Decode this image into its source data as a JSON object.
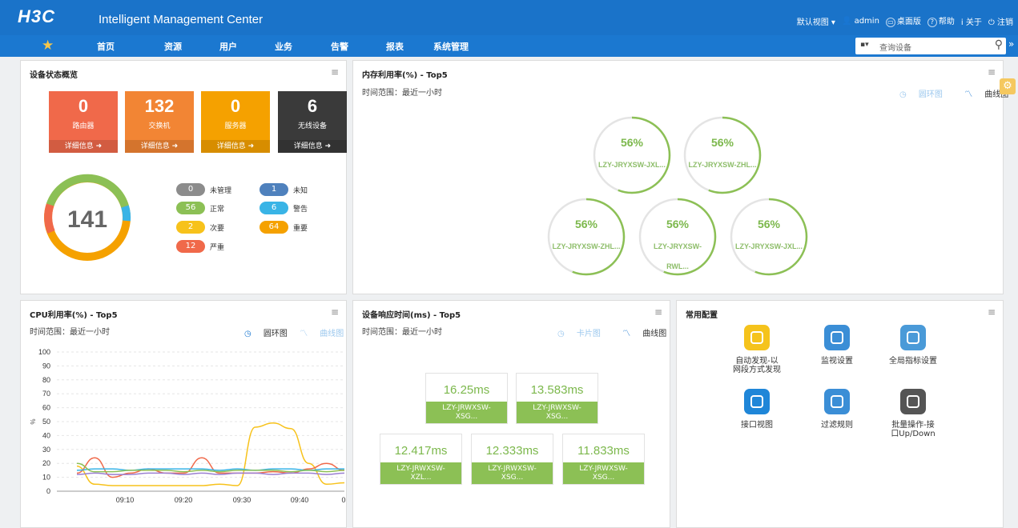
{
  "header": {
    "logo": "H3C",
    "title": "Intelligent Management Center",
    "default_view": "默认视图",
    "user": "admin",
    "desktop": "桌面版",
    "help": "帮助",
    "about": "关于",
    "logout": "注销"
  },
  "nav": {
    "items": [
      "首页",
      "资源",
      "用户",
      "业务",
      "告警",
      "报表",
      "系统管理"
    ],
    "search_placeholder": "查询设备"
  },
  "status_panel": {
    "title": "设备状态概览",
    "tiles": [
      {
        "value": "0",
        "label": "路由器",
        "more": "详细信息",
        "color": "#f0694a"
      },
      {
        "value": "132",
        "label": "交换机",
        "more": "详细信息",
        "color": "#f28534"
      },
      {
        "value": "0",
        "label": "服务器",
        "more": "详细信息",
        "color": "#f5a100"
      },
      {
        "value": "6",
        "label": "无线设备",
        "more": "详细信息",
        "color": "#3a3a3a"
      }
    ],
    "total": "141",
    "legend": [
      {
        "count": "0",
        "label": "未管理",
        "color": "#8c8c8c"
      },
      {
        "count": "1",
        "label": "未知",
        "color": "#4f81bd"
      },
      {
        "count": "56",
        "label": "正常",
        "color": "#8cc055"
      },
      {
        "count": "6",
        "label": "警告",
        "color": "#39b4e6"
      },
      {
        "count": "2",
        "label": "次要",
        "color": "#f7c21b"
      },
      {
        "count": "64",
        "label": "重要",
        "color": "#f5a100"
      },
      {
        "count": "12",
        "label": "严重",
        "color": "#f0694a"
      }
    ]
  },
  "memory_panel": {
    "title": "内存利用率(%) - Top5",
    "time_range": "时间范围：最近一小时",
    "ring_view": "圆环图",
    "line_view": "曲线图",
    "gauges": [
      {
        "pct": "56%",
        "name": "LZY-JRYXSW-JXL..."
      },
      {
        "pct": "56%",
        "name": "LZY-JRYXSW-ZHL..."
      },
      {
        "pct": "56%",
        "name": "LZY-JRYXSW-ZHL..."
      },
      {
        "pct": "56%",
        "name": "LZY-JRYXSW-",
        "name2": "RWL..."
      },
      {
        "pct": "56%",
        "name": "LZY-JRYXSW-JXL..."
      }
    ]
  },
  "cpu_panel": {
    "title": "CPU利用率(%) - Top5",
    "time_range": "时间范围：最近一小时",
    "ring_view": "圆环图",
    "line_view": "曲线图"
  },
  "chart_data": {
    "type": "line",
    "ylabel": "%",
    "ylim": [
      0,
      100
    ],
    "yticks": [
      0,
      10,
      20,
      30,
      40,
      50,
      60,
      70,
      80,
      90,
      100
    ],
    "xticks": [
      "09:10",
      "09:20",
      "09:30",
      "09:40",
      "0"
    ],
    "grid": true,
    "series": [
      {
        "color": "#f7c21b",
        "values": [
          18,
          5,
          4,
          4,
          4,
          4,
          4,
          4,
          5,
          4,
          46,
          49,
          45,
          20,
          5,
          6
        ]
      },
      {
        "color": "#f0694a",
        "values": [
          13,
          24,
          10,
          13,
          16,
          13,
          13,
          24,
          13,
          13,
          13,
          14,
          13,
          16,
          20,
          15
        ]
      },
      {
        "color": "#39b4e6",
        "values": [
          15,
          16,
          16,
          15,
          16,
          16,
          16,
          16,
          15,
          16,
          15,
          16,
          16,
          15,
          16,
          16
        ]
      },
      {
        "color": "#9a7fd1",
        "values": [
          12,
          13,
          12,
          12,
          13,
          13,
          12,
          13,
          12,
          13,
          13,
          12,
          13,
          13,
          12,
          13
        ]
      },
      {
        "color": "#8cc055",
        "values": [
          20,
          14,
          14,
          15,
          15,
          15,
          14,
          15,
          14,
          15,
          15,
          15,
          14,
          15,
          14,
          15
        ]
      }
    ]
  },
  "response_panel": {
    "title": "设备响应时间(ms) - Top5",
    "time_range": "时间范围：最近一小时",
    "card_view": "卡片图",
    "line_view": "曲线图",
    "cards": [
      {
        "value": "16.25ms",
        "name": "LZY-JRWXSW-",
        "name2": "XSG..."
      },
      {
        "value": "13.583ms",
        "name": "LZY-JRWXSW-",
        "name2": "XSG..."
      },
      {
        "value": "12.417ms",
        "name": "LZY-JRWXSW-",
        "name2": "XZL..."
      },
      {
        "value": "12.333ms",
        "name": "LZY-JRWXSW-",
        "name2": "XSG..."
      },
      {
        "value": "11.833ms",
        "name": "LZY-JRWXSW-",
        "name2": "XSG..."
      }
    ]
  },
  "config_panel": {
    "title": "常用配置",
    "items": [
      {
        "label": "自动发现-以",
        "label2": "网段方式发现",
        "color": "#f5c31c"
      },
      {
        "label": "监视设置",
        "label2": "",
        "color": "#3b8ed6"
      },
      {
        "label": "全局指标设置",
        "label2": "",
        "color": "#4a9ad8"
      },
      {
        "label": "接口视图",
        "label2": "",
        "color": "#1f86d8"
      },
      {
        "label": "过滤规则",
        "label2": "",
        "color": "#3b8ed6"
      },
      {
        "label": "批量操作-接",
        "label2": "口Up/Down",
        "color": "#555555"
      }
    ]
  }
}
